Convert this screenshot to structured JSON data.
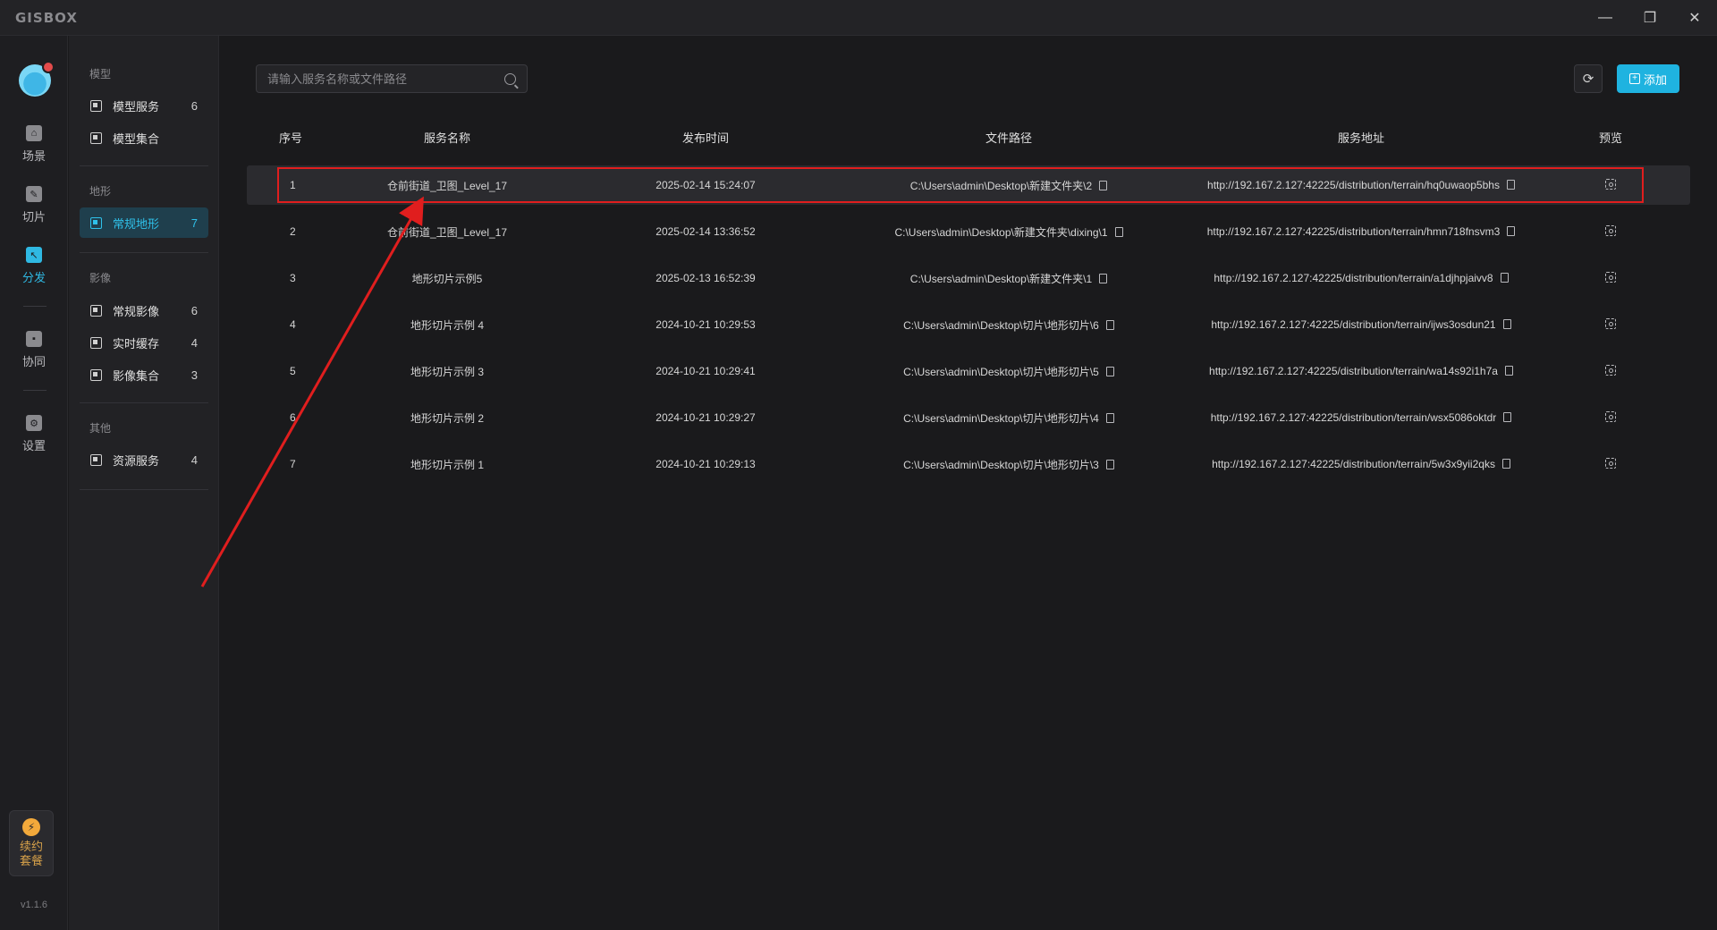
{
  "app": {
    "logo": "GISBOX",
    "version": "v1.1.6"
  },
  "window_controls": {
    "minimize": "—",
    "restore": "❐",
    "close": "✕"
  },
  "rail": {
    "items": [
      {
        "label": "场景",
        "icon": "scene-icon"
      },
      {
        "label": "切片",
        "icon": "slice-icon"
      },
      {
        "label": "分发",
        "icon": "distribute-icon"
      },
      {
        "label": "协同",
        "icon": "lock-icon"
      },
      {
        "label": "设置",
        "icon": "gear-icon"
      }
    ],
    "plan": {
      "line1": "续约",
      "line2": "套餐",
      "icon": "bolt-icon"
    }
  },
  "sidebar": {
    "groups": [
      {
        "title": "模型",
        "items": [
          {
            "label": "模型服务",
            "count": "6"
          },
          {
            "label": "模型集合",
            "count": ""
          }
        ]
      },
      {
        "title": "地形",
        "items": [
          {
            "label": "常规地形",
            "count": "7"
          }
        ]
      },
      {
        "title": "影像",
        "items": [
          {
            "label": "常规影像",
            "count": "6"
          },
          {
            "label": "实时缓存",
            "count": "4"
          },
          {
            "label": "影像集合",
            "count": "3"
          }
        ]
      },
      {
        "title": "其他",
        "items": [
          {
            "label": "资源服务",
            "count": "4"
          }
        ]
      }
    ]
  },
  "toolbar": {
    "search_placeholder": "请输入服务名称或文件路径",
    "add_label": "添加"
  },
  "table": {
    "headers": [
      "序号",
      "服务名称",
      "发布时间",
      "文件路径",
      "服务地址",
      "预览"
    ],
    "rows": [
      {
        "idx": "1",
        "name": "仓前街道_卫图_Level_17",
        "time": "2025-02-14 15:24:07",
        "path": "C:\\Users\\admin\\Desktop\\新建文件夹\\2",
        "url": "http://192.167.2.127:42225/distribution/terrain/hq0uwaop5bhs"
      },
      {
        "idx": "2",
        "name": "仓前街道_卫图_Level_17",
        "time": "2025-02-14 13:36:52",
        "path": "C:\\Users\\admin\\Desktop\\新建文件夹\\dixing\\1",
        "url": "http://192.167.2.127:42225/distribution/terrain/hmn718fnsvm3"
      },
      {
        "idx": "3",
        "name": "地形切片示例5",
        "time": "2025-02-13 16:52:39",
        "path": "C:\\Users\\admin\\Desktop\\新建文件夹\\1",
        "url": "http://192.167.2.127:42225/distribution/terrain/a1djhpjaivv8"
      },
      {
        "idx": "4",
        "name": "地形切片示例 4",
        "time": "2024-10-21 10:29:53",
        "path": "C:\\Users\\admin\\Desktop\\切片\\地形切片\\6",
        "url": "http://192.167.2.127:42225/distribution/terrain/ijws3osdun21"
      },
      {
        "idx": "5",
        "name": "地形切片示例 3",
        "time": "2024-10-21 10:29:41",
        "path": "C:\\Users\\admin\\Desktop\\切片\\地形切片\\5",
        "url": "http://192.167.2.127:42225/distribution/terrain/wa14s92i1h7a"
      },
      {
        "idx": "6",
        "name": "地形切片示例 2",
        "time": "2024-10-21 10:29:27",
        "path": "C:\\Users\\admin\\Desktop\\切片\\地形切片\\4",
        "url": "http://192.167.2.127:42225/distribution/terrain/wsx5086oktdr"
      },
      {
        "idx": "7",
        "name": "地形切片示例 1",
        "time": "2024-10-21 10:29:13",
        "path": "C:\\Users\\admin\\Desktop\\切片\\地形切片\\3",
        "url": "http://192.167.2.127:42225/distribution/terrain/5w3x9yii2qks"
      }
    ]
  },
  "colors": {
    "accent": "#1fb3e0",
    "annotation": "#e01e1e",
    "background": "#1a1a1c"
  }
}
